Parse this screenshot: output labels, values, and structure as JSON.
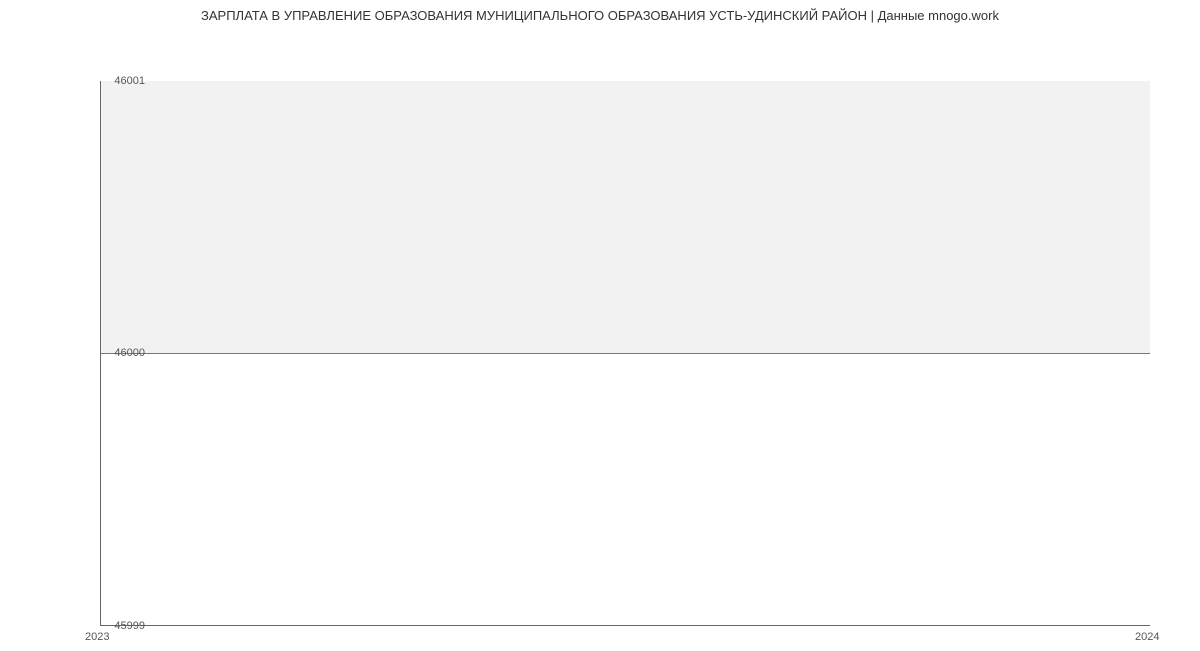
{
  "chart_data": {
    "type": "line",
    "title": "ЗАРПЛАТА В УПРАВЛЕНИЕ ОБРАЗОВАНИЯ МУНИЦИПАЛЬНОГО ОБРАЗОВАНИЯ УСТЬ-УДИНСКИЙ РАЙОН | Данные mnogo.work",
    "x": [
      "2023",
      "2024"
    ],
    "values": [
      46000,
      46000
    ],
    "xlabel": "",
    "ylabel": "",
    "ylim": [
      45999,
      46001
    ],
    "y_ticks": [
      "46001",
      "46000",
      "45999"
    ],
    "x_ticks": [
      "2023",
      "2024"
    ],
    "line_color": "#4a7ec9"
  }
}
